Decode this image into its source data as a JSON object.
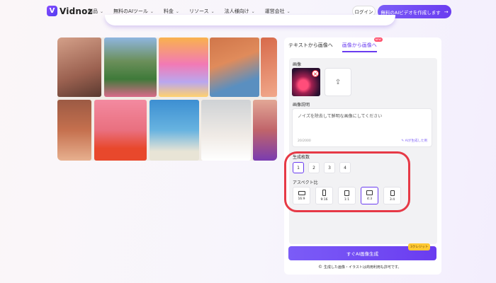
{
  "nav": {
    "logo_mark": "V",
    "logo_text": "Vidnoz",
    "menu": [
      "製品",
      "無料のAIツール",
      "料金",
      "リソース",
      "法人様向け",
      "運営会社"
    ],
    "login": "ログイン",
    "cta": "無料のAIビデオを作成します",
    "cta_arrow": "→"
  },
  "panel": {
    "tab_text_to_image": "テキストから画像へ",
    "tab_image_to_image": "画像から画像へ",
    "new_badge": "NEW",
    "image_label": "画像",
    "thumb_remove": "×",
    "upload_icon": "⇪",
    "desc_label": "画像説明",
    "desc_text": "ノイズを除去して鮮明な画像にしてください",
    "char_count": "20/2000",
    "ai_generate": "AIが生成した例",
    "count_label": "生成枚数",
    "counts": [
      "1",
      "2",
      "3",
      "4"
    ],
    "selected_count": "1",
    "aspect_label": "アスペクト比",
    "aspects": [
      "16:9",
      "9:16",
      "1:1",
      "4:3",
      "3:4"
    ],
    "selected_aspect": "4:3",
    "generate": "すぐAI画像生成",
    "credit": "3クレジット",
    "notice_icon": "©",
    "notice": "生成した画像・イラストは商用利用も許可です。"
  },
  "colors": {
    "accent": "#6a3cf0",
    "highlight": "#e63946"
  },
  "icons": {
    "chevron": "chevron-down-icon",
    "cta": "arrow-right-icon",
    "upload": "upload-icon",
    "remove": "close-icon",
    "notice": "copyright-icon"
  }
}
